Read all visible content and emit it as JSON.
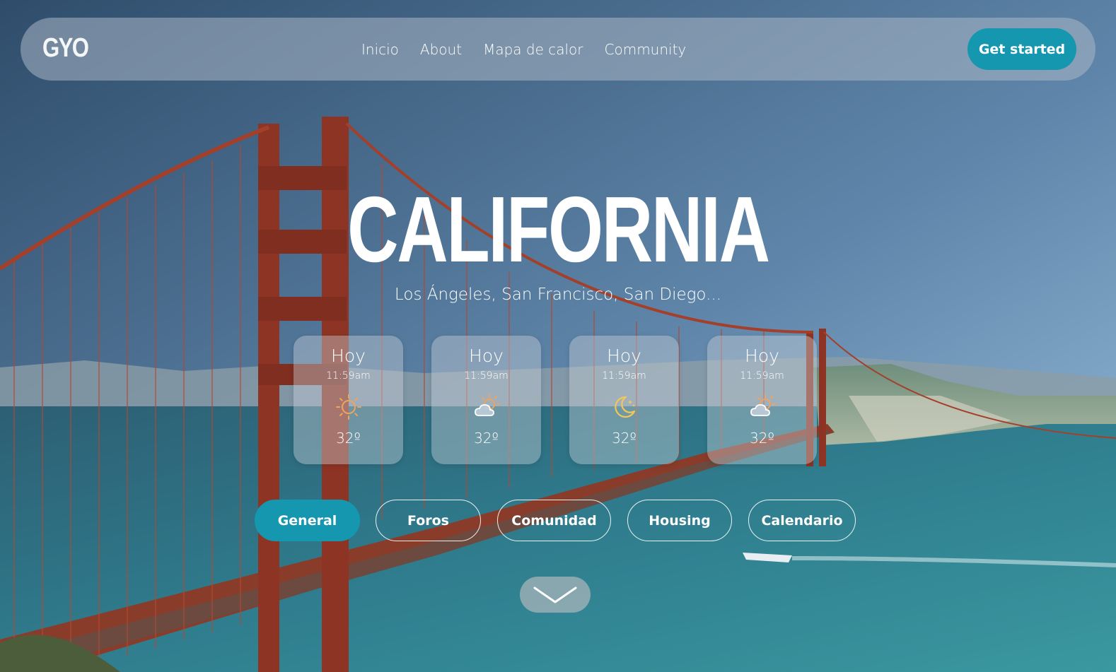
{
  "nav": {
    "logo": "GYO",
    "links": [
      "Inicio",
      "About",
      "Mapa de calor",
      "Community"
    ],
    "cta_label": "Get started"
  },
  "hero": {
    "title": "CALIFORNIA",
    "subtitle": "Los Ángeles, San Francisco, San Diego..."
  },
  "weather_cards": [
    {
      "day": "Hoy",
      "time": "11:59am",
      "icon": "sun-icon",
      "temp": "32º"
    },
    {
      "day": "Hoy",
      "time": "11:59am",
      "icon": "partly-cloudy-icon",
      "temp": "32º"
    },
    {
      "day": "Hoy",
      "time": "11:59am",
      "icon": "moon-stars-icon",
      "temp": "32º"
    },
    {
      "day": "Hoy",
      "time": "11:59am",
      "icon": "partly-cloudy-icon",
      "temp": "32º"
    }
  ],
  "tabs": [
    {
      "label": "General",
      "active": true
    },
    {
      "label": "Foros",
      "active": false
    },
    {
      "label": "Comunidad",
      "active": false
    },
    {
      "label": "Housing",
      "active": false
    },
    {
      "label": "Calendario",
      "active": false
    }
  ],
  "scroll_icon": "chevron-down-icon",
  "colors": {
    "accent": "#1697b0",
    "sun": "#f0a35e",
    "moon": "#f2c75a"
  }
}
